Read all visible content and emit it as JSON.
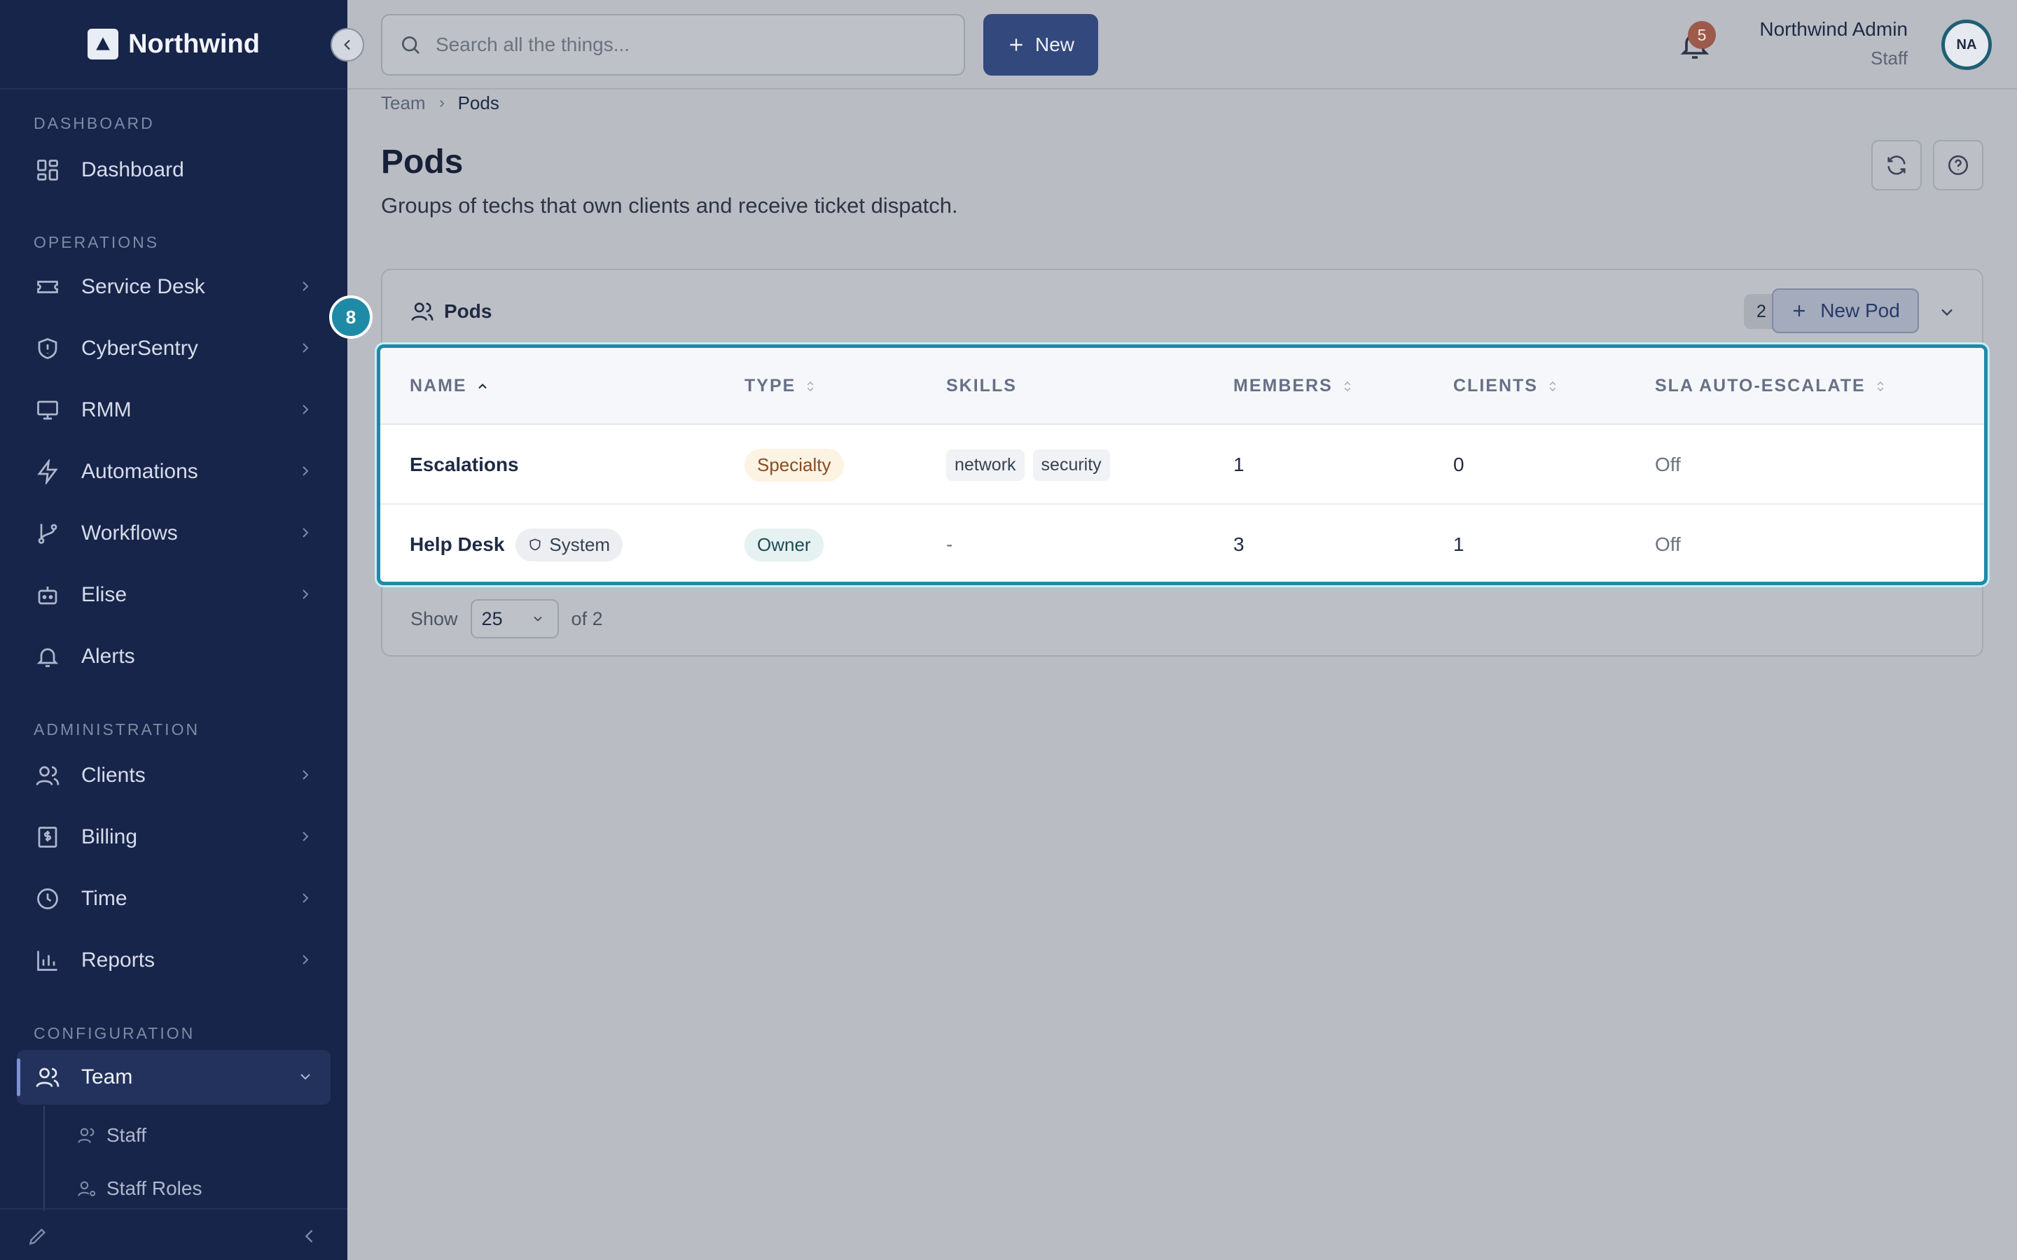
{
  "app": {
    "name": "Northwind"
  },
  "sidebar": {
    "sections": {
      "dashboard": "DASHBOARD",
      "operations": "OPERATIONS",
      "administration": "ADMINISTRATION",
      "configuration": "CONFIGURATION"
    },
    "items": {
      "dashboard": "Dashboard",
      "service_desk": "Service Desk",
      "cybersentry": "CyberSentry",
      "rmm": "RMM",
      "automations": "Automations",
      "workflows": "Workflows",
      "elise": "Elise",
      "alerts": "Alerts",
      "clients": "Clients",
      "billing": "Billing",
      "time": "Time",
      "reports": "Reports",
      "team": "Team"
    },
    "sub_items": {
      "staff": "Staff",
      "staff_roles": "Staff Roles"
    },
    "active": "Team"
  },
  "topbar": {
    "search_placeholder": "Search all the things...",
    "new_label": "New",
    "notification_count": "5",
    "user_name": "Northwind Admin",
    "user_role": "Staff",
    "avatar_initials": "NA"
  },
  "breadcrumb": {
    "parent": "Team",
    "current": "Pods"
  },
  "page": {
    "title": "Pods",
    "description": "Groups of techs that own clients and receive ticket dispatch."
  },
  "card": {
    "title": "Pods",
    "count": "2",
    "new_button": "New Pod",
    "marker": "8"
  },
  "table": {
    "headers": {
      "name": "NAME",
      "type": "TYPE",
      "skills": "SKILLS",
      "members": "MEMBERS",
      "clients": "CLIENTS",
      "sla": "SLA AUTO-ESCALATE"
    },
    "sort": {
      "column": "NAME",
      "direction": "ascending"
    },
    "rows": [
      {
        "name": "Escalations",
        "badge": "",
        "type": "Specialty",
        "skills": [
          "network",
          "security"
        ],
        "members": "1",
        "clients": "0",
        "sla": "Off"
      },
      {
        "name": "Help Desk",
        "badge": "System",
        "type": "Owner",
        "skills_empty": "-",
        "members": "3",
        "clients": "1",
        "sla": "Off"
      }
    ]
  },
  "pagination": {
    "show_label": "Show",
    "page_size": "25",
    "total_label": "of 2"
  },
  "colors": {
    "sidebar_bg": "#17254a",
    "primary": "#33487c",
    "highlight": "#1f8aa6",
    "notification": "#9c5a4a"
  }
}
